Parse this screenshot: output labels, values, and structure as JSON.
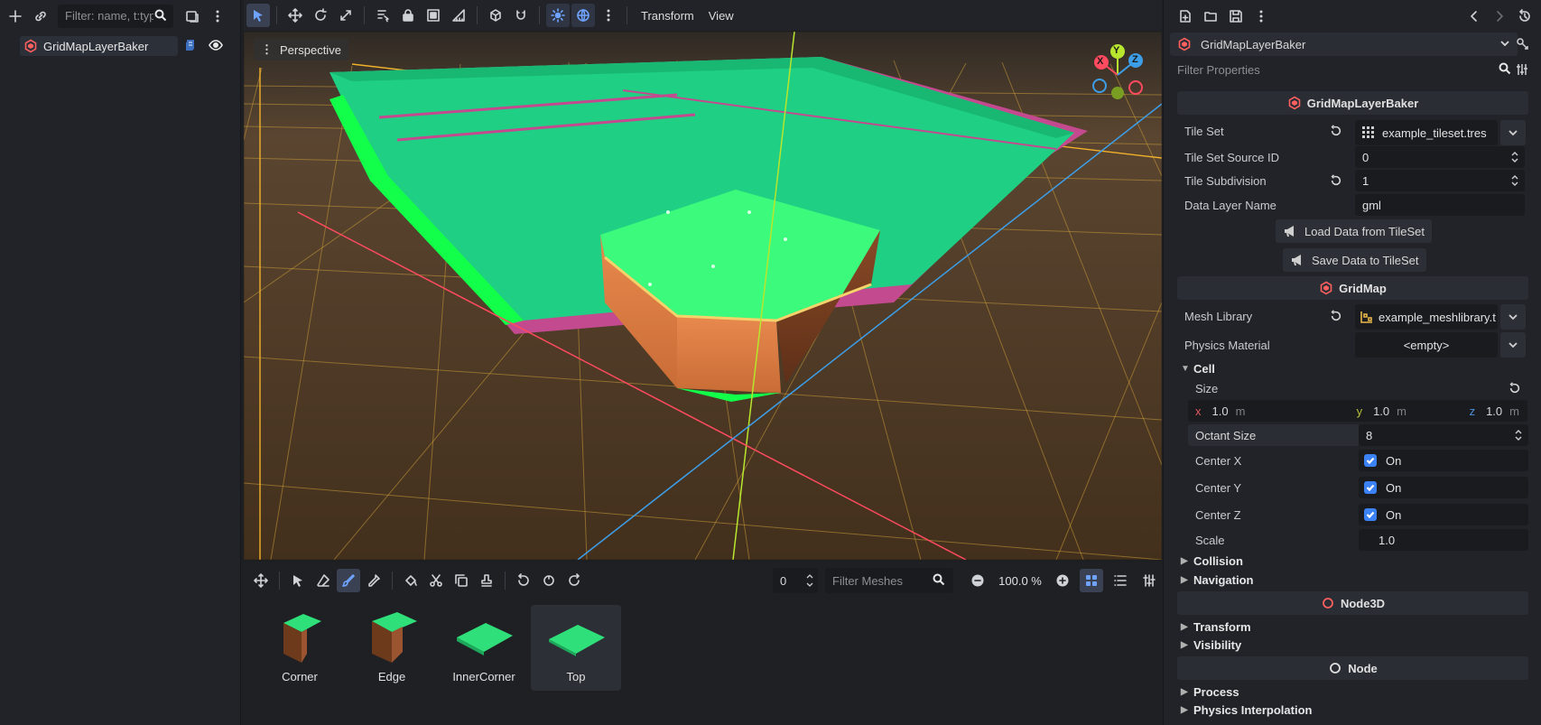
{
  "scene": {
    "filter_placeholder": "Filter: name, t:typ",
    "root_node": "GridMapLayerBaker"
  },
  "viewport": {
    "menu_transform": "Transform",
    "menu_view": "View",
    "perspective_label": "Perspective",
    "gizmo": {
      "x": "X",
      "y": "Y",
      "z": "Z"
    }
  },
  "gridmap_panel": {
    "floor_value": "0",
    "filter_placeholder": "Filter Meshes",
    "zoom": "100.0 %",
    "meshes": [
      {
        "name": "Corner"
      },
      {
        "name": "Edge"
      },
      {
        "name": "InnerCorner"
      },
      {
        "name": "Top",
        "selected": true
      }
    ]
  },
  "inspector": {
    "object_name": "GridMapLayerBaker",
    "filter_placeholder": "Filter Properties",
    "section_baker": "GridMapLayerBaker",
    "tile_set_label": "Tile Set",
    "tile_set_value": "example_tileset.tres",
    "tile_set_source_id_label": "Tile Set Source ID",
    "tile_set_source_id_value": "0",
    "tile_subdivision_label": "Tile Subdivision",
    "tile_subdivision_value": "1",
    "data_layer_name_label": "Data Layer Name",
    "data_layer_name_value": "gml",
    "load_button": "Load Data from TileSet",
    "save_button": "Save Data to TileSet",
    "section_gridmap": "GridMap",
    "mesh_library_label": "Mesh Library",
    "mesh_library_value": "example_meshlibrary.t",
    "physics_material_label": "Physics Material",
    "physics_material_value": "<empty>",
    "cell_group": "Cell",
    "size_label": "Size",
    "size_x_axis": "x",
    "size_x": "1.0",
    "size_y_axis": "y",
    "size_y": "1.0",
    "size_z_axis": "z",
    "size_z": "1.0",
    "size_unit": "m",
    "octant_size_label": "Octant Size",
    "octant_size_value": "8",
    "center_x_label": "Center X",
    "center_y_label": "Center Y",
    "center_z_label": "Center Z",
    "center_on": "On",
    "scale_label": "Scale",
    "scale_value": "1.0",
    "collision_group": "Collision",
    "navigation_group": "Navigation",
    "section_node3d": "Node3D",
    "transform_group": "Transform",
    "visibility_group": "Visibility",
    "section_node": "Node",
    "process_group": "Process",
    "physics_interp_group": "Physics Interpolation"
  },
  "colors": {
    "accent": "#6ea3ff",
    "checkbox": "#3b82f6",
    "grass": "#22d98a",
    "dirt": "#e0864f",
    "axis_x": "#ff4a5f",
    "axis_y": "#b8e62e",
    "axis_z": "#3d9ee8"
  }
}
